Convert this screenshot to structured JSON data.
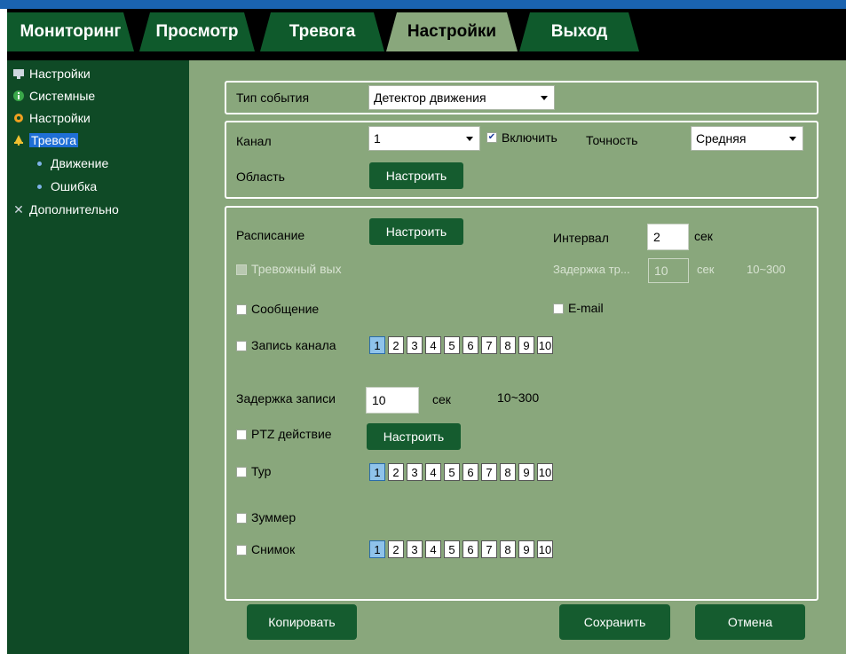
{
  "tabs": [
    {
      "label": "Мониторинг"
    },
    {
      "label": "Просмотр"
    },
    {
      "label": "Тревога"
    },
    {
      "label": "Настройки"
    },
    {
      "label": "Выход"
    }
  ],
  "sidebar": {
    "items": [
      {
        "label": "Настройки",
        "icon": "monitor-icon"
      },
      {
        "label": "Системные",
        "icon": "info-icon"
      },
      {
        "label": "Настройки",
        "icon": "gear-icon"
      },
      {
        "label": "Тревога",
        "icon": "bell-icon"
      },
      {
        "label": "Движение",
        "icon": "bullet-icon"
      },
      {
        "label": "Ошибка",
        "icon": "bullet-icon"
      },
      {
        "label": "Дополнительно",
        "icon": "tools-icon"
      }
    ]
  },
  "event": {
    "label": "Тип события",
    "value": "Детектор движения"
  },
  "channel": {
    "label": "Канал",
    "value": "1",
    "enable_label": "Включить",
    "precision_label": "Точность",
    "precision_value": "Средняя"
  },
  "area": {
    "label": "Область",
    "button": "Настроить"
  },
  "schedule": {
    "label": "Расписание",
    "button": "Настроить",
    "interval_label": "Интервал",
    "interval_value": "2",
    "interval_unit": "сек"
  },
  "alarm_out": {
    "label": "Тревожный вых",
    "delay_label": "Задержка тр...",
    "delay_value": "10",
    "delay_unit": "сек",
    "delay_range": "10~300"
  },
  "message": {
    "label": "Сообщение",
    "email_label": "E-mail"
  },
  "record": {
    "label": "Запись канала"
  },
  "record_delay": {
    "label": "Задержка записи",
    "value": "10",
    "unit": "сек",
    "range": "10~300"
  },
  "ptz": {
    "label": "PTZ действие",
    "button": "Настроить"
  },
  "tour": {
    "label": "Тур"
  },
  "buzzer": {
    "label": "Зуммер"
  },
  "snapshot": {
    "label": "Снимок"
  },
  "channels": [
    "1",
    "2",
    "3",
    "4",
    "5",
    "6",
    "7",
    "8",
    "9",
    "10"
  ],
  "footer": {
    "copy": "Копировать",
    "save": "Сохранить",
    "cancel": "Отмена"
  },
  "colors": {
    "accent": "#89a77c",
    "dark_green": "#155c2f",
    "sidebar": "#0f4a26",
    "selected": "#1f6fd6"
  }
}
